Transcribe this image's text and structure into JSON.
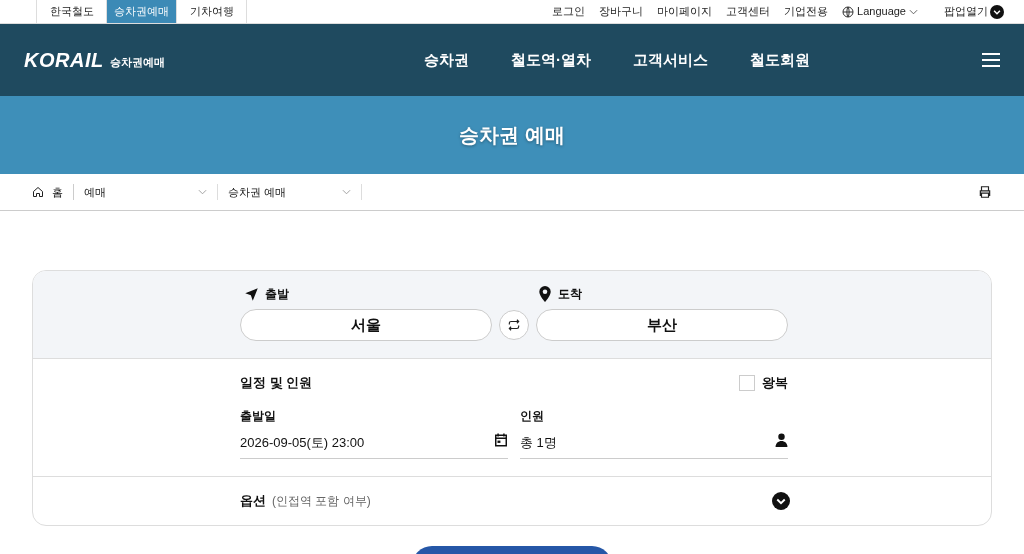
{
  "top_tabs": [
    {
      "label": "한국철도",
      "selected": false
    },
    {
      "label": "승차권예매",
      "selected": true
    },
    {
      "label": "기차여행",
      "selected": false
    }
  ],
  "util_links": [
    "로그인",
    "장바구니",
    "마이페이지",
    "고객센터",
    "기업전용"
  ],
  "language": "Language",
  "popup": "팝업열기",
  "header": {
    "logo": "KORAIL",
    "logo_sub": "승차권예매",
    "nav": [
      "승차권",
      "철도역·열차",
      "고객서비스",
      "철도회원"
    ]
  },
  "banner_title": "승차권 예매",
  "breadcrumb": {
    "home": "홈",
    "levels": [
      "예매",
      "승차권 예매"
    ]
  },
  "route": {
    "departure_label": "출발",
    "departure": "서울",
    "arrival_label": "도착",
    "arrival": "부산"
  },
  "schedule": {
    "title": "일정 및 인원",
    "round_trip": {
      "label": "왕복",
      "checked": false
    },
    "date_label": "출발일",
    "date": "2026-09-05(토) 23:00",
    "people_label": "인원",
    "people": "총 1명"
  },
  "options": {
    "title": "옵션",
    "note": "(인접역 포함 여부)",
    "expanded": false
  }
}
